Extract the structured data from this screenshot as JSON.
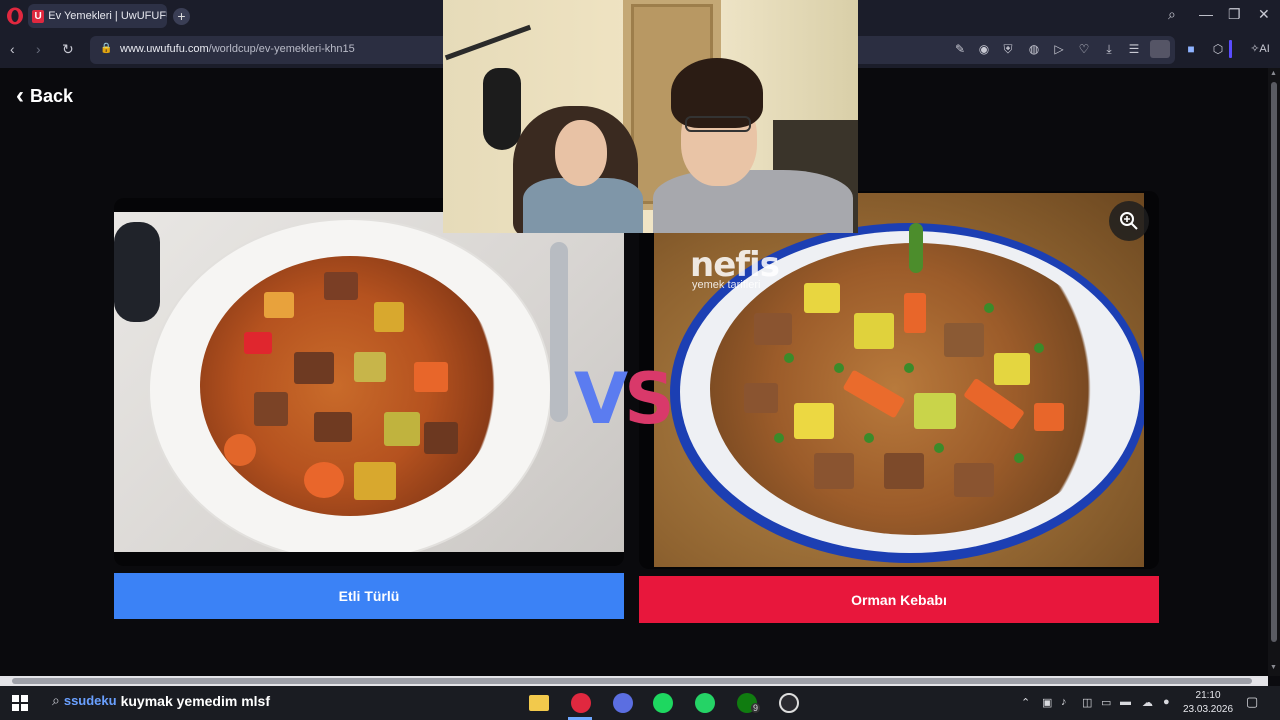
{
  "browser": {
    "tab_title": "Ev Yemekleri | UwUFUFU",
    "tab_favicon": "U",
    "url_domain": "www.uwufufu.com",
    "url_path": "/worldcup/ev-yemekleri-khn15",
    "ai_label": "AI",
    "accent": "#e0283f"
  },
  "page": {
    "back_label": "Back",
    "vs_v": "V",
    "vs_s": "S",
    "left_choice": {
      "label": "Etli Türlü",
      "color": "#3b82f6"
    },
    "right_choice": {
      "label": "Orman Kebabı",
      "color": "#e8173c"
    },
    "watermark_main": "nefis",
    "watermark_sub": "yemek tarifleri"
  },
  "taskbar": {
    "search_text": "kuymak yemedim mlsf",
    "search_prefix": "ssudeku",
    "xbox_badge": "9",
    "time": "21:10",
    "date": "23.03.2026"
  }
}
